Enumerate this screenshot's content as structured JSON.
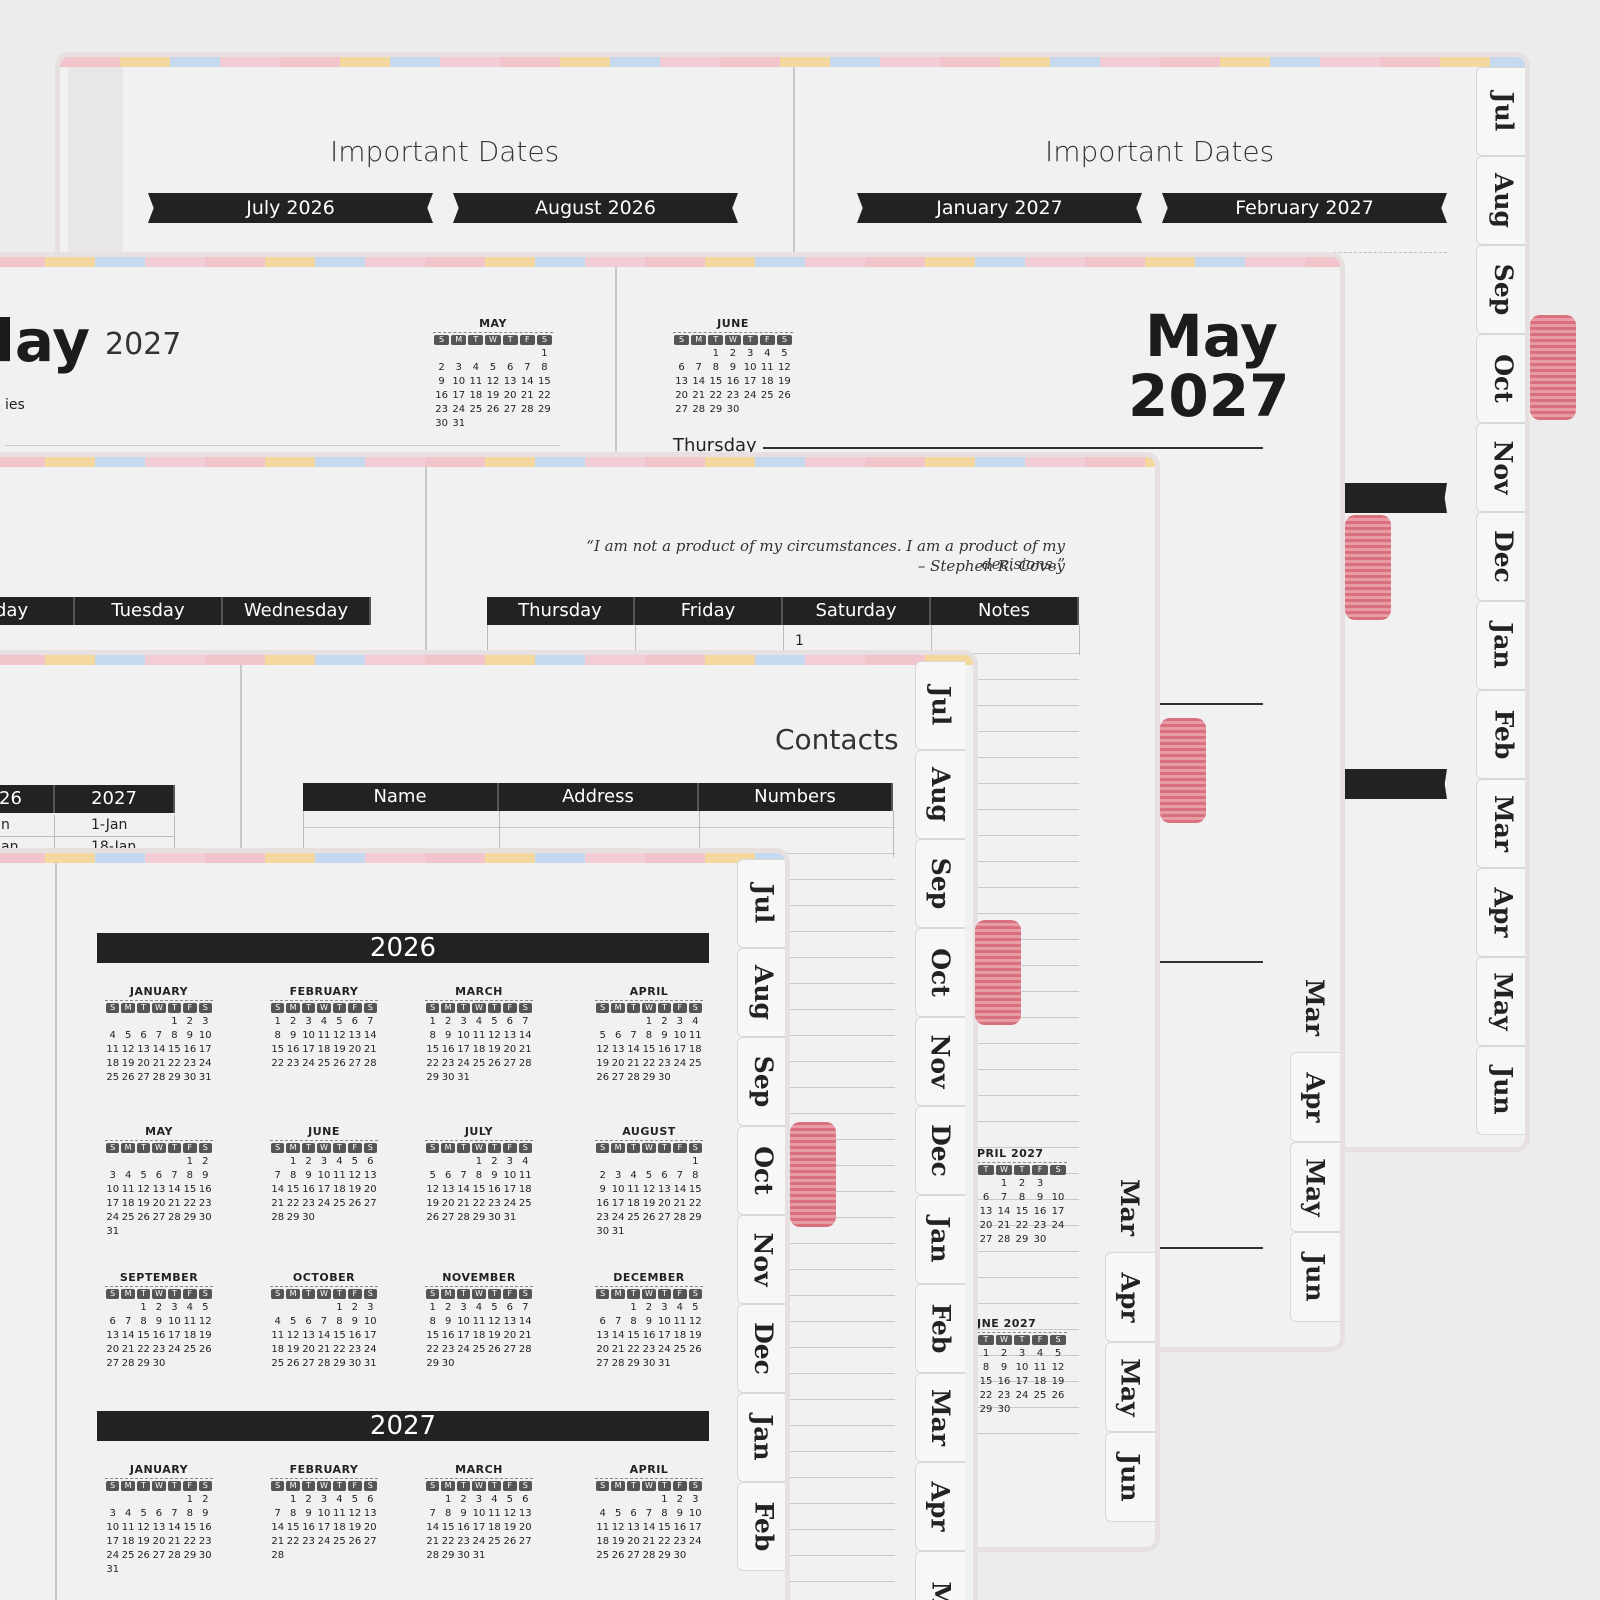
{
  "tabs_labels": [
    "Jul",
    "Aug",
    "Sep",
    "Oct",
    "Nov",
    "Dec",
    "Jan",
    "Feb",
    "Mar",
    "Apr",
    "May",
    "Jun"
  ],
  "layer1": {
    "left_title": "Important Dates",
    "left_ribbons": [
      "July 2026",
      "August 2026"
    ],
    "right_title": "Important Dates",
    "right_ribbons": [
      "January 2027",
      "February 2027"
    ]
  },
  "layer2": {
    "left_month_fragment": "lay",
    "left_year": "2027",
    "left_side_fragment": "ies",
    "right_month": "May",
    "right_year": "2027",
    "day_label": "Thursday",
    "lower_tabs": [
      "Mar",
      "Apr",
      "May",
      "Jun"
    ],
    "mini_may": {
      "title": "MAY",
      "weeks": [
        [
          "",
          "",
          "",
          "",
          "",
          "",
          "1"
        ],
        [
          "2",
          "3",
          "4",
          "5",
          "6",
          "7",
          "8"
        ],
        [
          "9",
          "10",
          "11",
          "12",
          "13",
          "14",
          "15"
        ],
        [
          "16",
          "17",
          "18",
          "19",
          "20",
          "21",
          "22"
        ],
        [
          "23",
          "24",
          "25",
          "26",
          "27",
          "28",
          "29"
        ],
        [
          "30",
          "31",
          "",
          "",
          "",
          "",
          ""
        ]
      ]
    },
    "mini_june": {
      "title": "JUNE",
      "weeks": [
        [
          "",
          "",
          "1",
          "2",
          "3",
          "4",
          "5"
        ],
        [
          "6",
          "7",
          "8",
          "9",
          "10",
          "11",
          "12"
        ],
        [
          "13",
          "14",
          "15",
          "16",
          "17",
          "18",
          "19"
        ],
        [
          "20",
          "21",
          "22",
          "23",
          "24",
          "25",
          "26"
        ],
        [
          "27",
          "28",
          "29",
          "30",
          "",
          "",
          ""
        ]
      ]
    }
  },
  "layer3": {
    "quote": "“I am not a product of my circumstances. I am a product of my decisions.”",
    "author": "– Stephen R. Covey",
    "left_headers": [
      "day",
      "Tuesday",
      "Wednesday"
    ],
    "right_headers": [
      "Thursday",
      "Friday",
      "Saturday",
      "Notes"
    ],
    "saturday_date": "1",
    "lower_tabs": [
      "Mar",
      "Apr",
      "May",
      "Jun"
    ],
    "mini_april_title": "PRIL 2027",
    "mini_june_title": "JNE 2027",
    "mini_april_weeks": [
      [
        "",
        "1",
        "2",
        "3"
      ],
      [
        "6",
        "7",
        "8",
        "9",
        "10"
      ],
      [
        "13",
        "14",
        "15",
        "16",
        "17"
      ],
      [
        "20",
        "21",
        "22",
        "23",
        "24"
      ],
      [
        "27",
        "28",
        "29",
        "30"
      ]
    ],
    "mini_june_weeks": [
      [
        "1",
        "2",
        "3",
        "4",
        "5"
      ],
      [
        "8",
        "9",
        "10",
        "11",
        "12"
      ],
      [
        "15",
        "16",
        "17",
        "18",
        "19"
      ],
      [
        "22",
        "23",
        "24",
        "25",
        "26"
      ],
      [
        "29",
        "30"
      ]
    ]
  },
  "layer4": {
    "contacts_title": "Contacts",
    "contact_headers": [
      "Name",
      "Address",
      "Numbers"
    ],
    "holiday_headers": [
      "26",
      "2027"
    ],
    "holiday_rows": [
      [
        "n",
        "1-Jan"
      ],
      [
        "an",
        "18-Jan"
      ]
    ],
    "tabs": [
      "Jul",
      "Aug",
      "Sep",
      "Oct",
      "Nov",
      "Dec",
      "Jan",
      "Feb",
      "Mar",
      "Apr",
      "M"
    ]
  },
  "layer5": {
    "year1": "2026",
    "year2": "2027",
    "tabs": [
      "Jul",
      "Aug",
      "Sep",
      "Oct",
      "Nov",
      "Dec",
      "Jan",
      "Feb"
    ],
    "months_2026": [
      {
        "title": "JANUARY",
        "weeks": [
          [
            "",
            "",
            "",
            "",
            "1",
            "2",
            "3"
          ],
          [
            "4",
            "5",
            "6",
            "7",
            "8",
            "9",
            "10"
          ],
          [
            "11",
            "12",
            "13",
            "14",
            "15",
            "16",
            "17"
          ],
          [
            "18",
            "19",
            "20",
            "21",
            "22",
            "23",
            "24"
          ],
          [
            "25",
            "26",
            "27",
            "28",
            "29",
            "30",
            "31"
          ]
        ]
      },
      {
        "title": "FEBRUARY",
        "weeks": [
          [
            "1",
            "2",
            "3",
            "4",
            "5",
            "6",
            "7"
          ],
          [
            "8",
            "9",
            "10",
            "11",
            "12",
            "13",
            "14"
          ],
          [
            "15",
            "16",
            "17",
            "18",
            "19",
            "20",
            "21"
          ],
          [
            "22",
            "23",
            "24",
            "25",
            "26",
            "27",
            "28"
          ]
        ]
      },
      {
        "title": "MARCH",
        "weeks": [
          [
            "1",
            "2",
            "3",
            "4",
            "5",
            "6",
            "7"
          ],
          [
            "8",
            "9",
            "10",
            "11",
            "12",
            "13",
            "14"
          ],
          [
            "15",
            "16",
            "17",
            "18",
            "19",
            "20",
            "21"
          ],
          [
            "22",
            "23",
            "24",
            "25",
            "26",
            "27",
            "28"
          ],
          [
            "29",
            "30",
            "31",
            "",
            "",
            "",
            ""
          ]
        ]
      },
      {
        "title": "APRIL",
        "weeks": [
          [
            "",
            "",
            "",
            "1",
            "2",
            "3",
            "4"
          ],
          [
            "5",
            "6",
            "7",
            "8",
            "9",
            "10",
            "11"
          ],
          [
            "12",
            "13",
            "14",
            "15",
            "16",
            "17",
            "18"
          ],
          [
            "19",
            "20",
            "21",
            "22",
            "23",
            "24",
            "25"
          ],
          [
            "26",
            "27",
            "28",
            "29",
            "30",
            "",
            ""
          ]
        ]
      },
      {
        "title": "MAY",
        "weeks": [
          [
            "",
            "",
            "",
            "",
            "",
            "1",
            "2"
          ],
          [
            "3",
            "4",
            "5",
            "6",
            "7",
            "8",
            "9"
          ],
          [
            "10",
            "11",
            "12",
            "13",
            "14",
            "15",
            "16"
          ],
          [
            "17",
            "18",
            "19",
            "20",
            "21",
            "22",
            "23"
          ],
          [
            "24",
            "25",
            "26",
            "27",
            "28",
            "29",
            "30"
          ],
          [
            "31",
            "",
            "",
            "",
            "",
            "",
            ""
          ]
        ]
      },
      {
        "title": "JUNE",
        "weeks": [
          [
            "",
            "1",
            "2",
            "3",
            "4",
            "5",
            "6"
          ],
          [
            "7",
            "8",
            "9",
            "10",
            "11",
            "12",
            "13"
          ],
          [
            "14",
            "15",
            "16",
            "17",
            "18",
            "19",
            "20"
          ],
          [
            "21",
            "22",
            "23",
            "24",
            "25",
            "26",
            "27"
          ],
          [
            "28",
            "29",
            "30",
            "",
            "",
            "",
            ""
          ]
        ]
      },
      {
        "title": "JULY",
        "weeks": [
          [
            "",
            "",
            "",
            "1",
            "2",
            "3",
            "4"
          ],
          [
            "5",
            "6",
            "7",
            "8",
            "9",
            "10",
            "11"
          ],
          [
            "12",
            "13",
            "14",
            "15",
            "16",
            "17",
            "18"
          ],
          [
            "19",
            "20",
            "21",
            "22",
            "23",
            "24",
            "25"
          ],
          [
            "26",
            "27",
            "28",
            "29",
            "30",
            "31",
            ""
          ]
        ]
      },
      {
        "title": "AUGUST",
        "weeks": [
          [
            "",
            "",
            "",
            "",
            "",
            "",
            "1"
          ],
          [
            "2",
            "3",
            "4",
            "5",
            "6",
            "7",
            "8"
          ],
          [
            "9",
            "10",
            "11",
            "12",
            "13",
            "14",
            "15"
          ],
          [
            "16",
            "17",
            "18",
            "19",
            "20",
            "21",
            "22"
          ],
          [
            "23",
            "24",
            "25",
            "26",
            "27",
            "28",
            "29"
          ],
          [
            "30",
            "31",
            "",
            "",
            "",
            "",
            ""
          ]
        ]
      },
      {
        "title": "SEPTEMBER",
        "weeks": [
          [
            "",
            "",
            "1",
            "2",
            "3",
            "4",
            "5"
          ],
          [
            "6",
            "7",
            "8",
            "9",
            "10",
            "11",
            "12"
          ],
          [
            "13",
            "14",
            "15",
            "16",
            "17",
            "18",
            "19"
          ],
          [
            "20",
            "21",
            "22",
            "23",
            "24",
            "25",
            "26"
          ],
          [
            "27",
            "28",
            "29",
            "30",
            "",
            "",
            ""
          ]
        ]
      },
      {
        "title": "OCTOBER",
        "weeks": [
          [
            "",
            "",
            "",
            "",
            "1",
            "2",
            "3"
          ],
          [
            "4",
            "5",
            "6",
            "7",
            "8",
            "9",
            "10"
          ],
          [
            "11",
            "12",
            "13",
            "14",
            "15",
            "16",
            "17"
          ],
          [
            "18",
            "19",
            "20",
            "21",
            "22",
            "23",
            "24"
          ],
          [
            "25",
            "26",
            "27",
            "28",
            "29",
            "30",
            "31"
          ]
        ]
      },
      {
        "title": "NOVEMBER",
        "weeks": [
          [
            "1",
            "2",
            "3",
            "4",
            "5",
            "6",
            "7"
          ],
          [
            "8",
            "9",
            "10",
            "11",
            "12",
            "13",
            "14"
          ],
          [
            "15",
            "16",
            "17",
            "18",
            "19",
            "20",
            "21"
          ],
          [
            "22",
            "23",
            "24",
            "25",
            "26",
            "27",
            "28"
          ],
          [
            "29",
            "30",
            "",
            "",
            "",
            "",
            ""
          ]
        ]
      },
      {
        "title": "DECEMBER",
        "weeks": [
          [
            "",
            "",
            "1",
            "2",
            "3",
            "4",
            "5"
          ],
          [
            "6",
            "7",
            "8",
            "9",
            "10",
            "11",
            "12"
          ],
          [
            "13",
            "14",
            "15",
            "16",
            "17",
            "18",
            "19"
          ],
          [
            "20",
            "21",
            "22",
            "23",
            "24",
            "25",
            "26"
          ],
          [
            "27",
            "28",
            "29",
            "30",
            "31",
            "",
            ""
          ]
        ]
      }
    ],
    "months_2027": [
      {
        "title": "JANUARY",
        "weeks": [
          [
            "",
            "",
            "",
            "",
            "",
            "1",
            "2"
          ],
          [
            "3",
            "4",
            "5",
            "6",
            "7",
            "8",
            "9"
          ],
          [
            "10",
            "11",
            "12",
            "13",
            "14",
            "15",
            "16"
          ],
          [
            "17",
            "18",
            "19",
            "20",
            "21",
            "22",
            "23"
          ],
          [
            "24",
            "25",
            "26",
            "27",
            "28",
            "29",
            "30"
          ],
          [
            "31",
            "",
            "",
            "",
            "",
            "",
            ""
          ]
        ]
      },
      {
        "title": "FEBRUARY",
        "weeks": [
          [
            "",
            "1",
            "2",
            "3",
            "4",
            "5",
            "6"
          ],
          [
            "7",
            "8",
            "9",
            "10",
            "11",
            "12",
            "13"
          ],
          [
            "14",
            "15",
            "16",
            "17",
            "18",
            "19",
            "20"
          ],
          [
            "21",
            "22",
            "23",
            "24",
            "25",
            "26",
            "27"
          ],
          [
            "28",
            "",
            "",
            "",
            "",
            "",
            ""
          ]
        ]
      },
      {
        "title": "MARCH",
        "weeks": [
          [
            "",
            "1",
            "2",
            "3",
            "4",
            "5",
            "6"
          ],
          [
            "7",
            "8",
            "9",
            "10",
            "11",
            "12",
            "13"
          ],
          [
            "14",
            "15",
            "16",
            "17",
            "18",
            "19",
            "20"
          ],
          [
            "21",
            "22",
            "23",
            "24",
            "25",
            "26",
            "27"
          ],
          [
            "28",
            "29",
            "30",
            "31",
            "",
            "",
            ""
          ]
        ]
      },
      {
        "title": "APRIL",
        "weeks": [
          [
            "",
            "",
            "",
            "",
            "1",
            "2",
            "3"
          ],
          [
            "4",
            "5",
            "6",
            "7",
            "8",
            "9",
            "10"
          ],
          [
            "11",
            "12",
            "13",
            "14",
            "15",
            "16",
            "17"
          ],
          [
            "18",
            "19",
            "20",
            "21",
            "22",
            "23",
            "24"
          ],
          [
            "25",
            "26",
            "27",
            "28",
            "29",
            "30",
            ""
          ]
        ]
      }
    ]
  },
  "weekday_letters": [
    "S",
    "M",
    "T",
    "W",
    "T",
    "F",
    "S"
  ]
}
